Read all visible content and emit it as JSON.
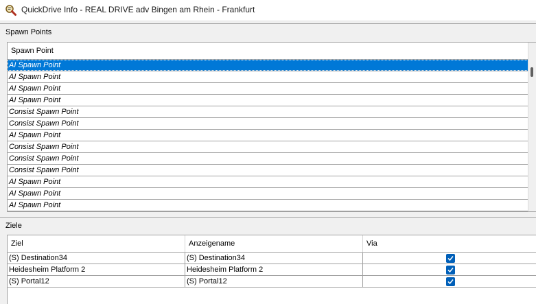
{
  "window": {
    "title": "QuickDrive Info - REAL DRIVE adv Bingen am Rhein - Frankfurt"
  },
  "spawn_points": {
    "section_label": "Spawn Points",
    "column_header": "Spawn Point",
    "selected_index": 0,
    "rows": [
      "AI Spawn Point",
      "AI Spawn Point",
      "AI Spawn Point",
      "AI Spawn Point",
      "Consist Spawn Point",
      "Consist Spawn Point",
      "AI Spawn Point",
      "Consist Spawn Point",
      "Consist Spawn Point",
      "Consist Spawn Point",
      "AI Spawn Point",
      "AI Spawn Point",
      "AI Spawn Point"
    ]
  },
  "ziele": {
    "section_label": "Ziele",
    "columns": {
      "ziel": "Ziel",
      "anzeigename": "Anzeigename",
      "via": "Via"
    },
    "rows": [
      {
        "ziel": "(S) Destination34",
        "anzeigename": "(S) Destination34",
        "via": true
      },
      {
        "ziel": "Heidesheim Platform 2",
        "anzeigename": "Heidesheim Platform 2",
        "via": true
      },
      {
        "ziel": "(S) Portal12",
        "anzeigename": "(S) Portal12",
        "via": true
      }
    ]
  },
  "colors": {
    "selection": "#0078d7",
    "checkbox": "#005fb8"
  },
  "icons": {
    "app": "magnifier-info-icon",
    "checked": "checkmark-icon"
  }
}
